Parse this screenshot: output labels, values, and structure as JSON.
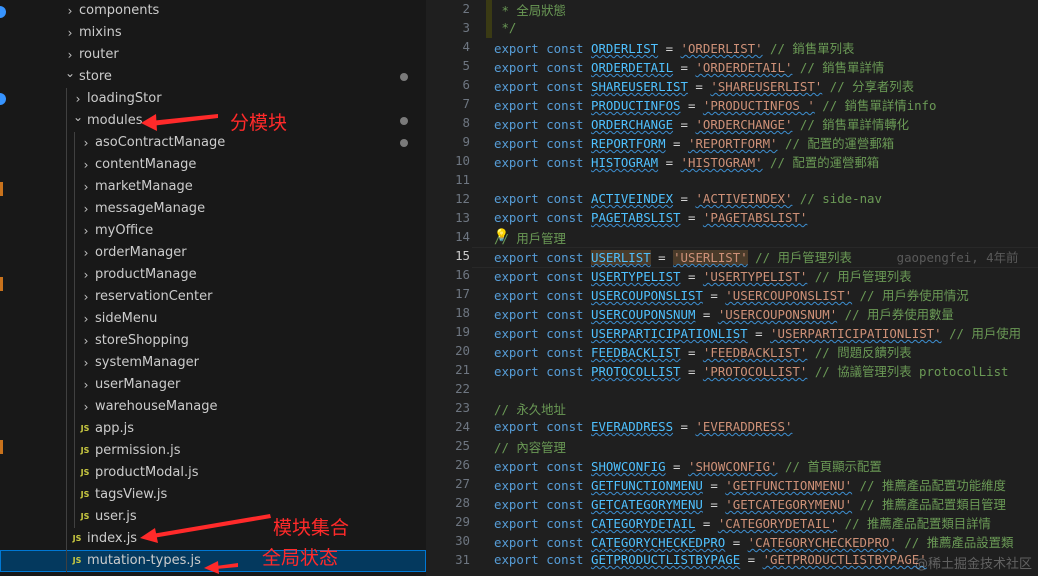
{
  "explorer": {
    "items": [
      {
        "label": "components",
        "type": "folder",
        "open": false,
        "depth": 1
      },
      {
        "label": "mixins",
        "type": "folder",
        "open": false,
        "depth": 1
      },
      {
        "label": "router",
        "type": "folder",
        "open": false,
        "depth": 1
      },
      {
        "label": "store",
        "type": "folder",
        "open": true,
        "depth": 1,
        "modified": true
      },
      {
        "label": "loadingStor",
        "type": "folder",
        "open": false,
        "depth": 2
      },
      {
        "label": "modules",
        "type": "folder",
        "open": true,
        "depth": 2,
        "modified": true
      },
      {
        "label": "asoContractManage",
        "type": "folder",
        "open": false,
        "depth": 3,
        "modified": true
      },
      {
        "label": "contentManage",
        "type": "folder",
        "open": false,
        "depth": 3
      },
      {
        "label": "marketManage",
        "type": "folder",
        "open": false,
        "depth": 3
      },
      {
        "label": "messageManage",
        "type": "folder",
        "open": false,
        "depth": 3
      },
      {
        "label": "myOffice",
        "type": "folder",
        "open": false,
        "depth": 3
      },
      {
        "label": "orderManager",
        "type": "folder",
        "open": false,
        "depth": 3
      },
      {
        "label": "productManage",
        "type": "folder",
        "open": false,
        "depth": 3
      },
      {
        "label": "reservationCenter",
        "type": "folder",
        "open": false,
        "depth": 3
      },
      {
        "label": "sideMenu",
        "type": "folder",
        "open": false,
        "depth": 3
      },
      {
        "label": "storeShopping",
        "type": "folder",
        "open": false,
        "depth": 3
      },
      {
        "label": "systemManager",
        "type": "folder",
        "open": false,
        "depth": 3
      },
      {
        "label": "userManager",
        "type": "folder",
        "open": false,
        "depth": 3
      },
      {
        "label": "warehouseManage",
        "type": "folder",
        "open": false,
        "depth": 3
      },
      {
        "label": "app.js",
        "type": "js",
        "depth": 3
      },
      {
        "label": "permission.js",
        "type": "js",
        "depth": 3
      },
      {
        "label": "productModal.js",
        "type": "js",
        "depth": 3
      },
      {
        "label": "tagsView.js",
        "type": "js",
        "depth": 3
      },
      {
        "label": "user.js",
        "type": "js",
        "depth": 3
      },
      {
        "label": "index.js",
        "type": "js",
        "depth": 2
      },
      {
        "label": "mutation-types.js",
        "type": "js",
        "depth": 2,
        "selected": true
      }
    ],
    "js_icon_text": "JS"
  },
  "annotations": {
    "modules_label": "分模块",
    "index_label": "模块集合",
    "mutation_label": "全局状态"
  },
  "editor": {
    "active_line": 15,
    "blame": "gaopengfei, 4年前",
    "lines": [
      {
        "n": 2,
        "t": "doc",
        "text": " * 全局狀態"
      },
      {
        "n": 3,
        "t": "doc",
        "text": " */"
      },
      {
        "n": 4,
        "t": "exp",
        "name": "ORDERLIST",
        "value": "'ORDERLIST'",
        "comment": "// 銷售單列表"
      },
      {
        "n": 5,
        "t": "exp",
        "name": "ORDERDETAIL",
        "value": "'ORDERDETAIL'",
        "comment": "// 銷售單詳情"
      },
      {
        "n": 6,
        "t": "exp",
        "name": "SHAREUSERLIST",
        "value": "'SHAREUSERLIST'",
        "comment": "// 分享者列表"
      },
      {
        "n": 7,
        "t": "exp",
        "name": "PRODUCTINFOS",
        "value": "'PRODUCTINFOS '",
        "comment": "// 銷售單詳情info"
      },
      {
        "n": 8,
        "t": "exp",
        "name": "ORDERCHANGE",
        "value": "'ORDERCHANGE'",
        "comment": "// 銷售單詳情轉化"
      },
      {
        "n": 9,
        "t": "exp",
        "name": "REPORTFORM",
        "value": "'REPORTFORM'",
        "comment": "// 配置的運營郵箱"
      },
      {
        "n": 10,
        "t": "exp",
        "name": "HISTOGRAM",
        "value": "'HISTOGRAM'",
        "comment": "// 配置的運營郵箱"
      },
      {
        "n": 11,
        "t": "blank"
      },
      {
        "n": 12,
        "t": "exp",
        "name": "ACTIVEINDEX",
        "value": "'ACTIVEINDEX'",
        "comment": "// side-nav"
      },
      {
        "n": 13,
        "t": "exp",
        "name": "PAGETABSLIST",
        "value": "'PAGETABSLIST'",
        "comment": ""
      },
      {
        "n": 14,
        "t": "cm",
        "text": "// 用戶管理"
      },
      {
        "n": 15,
        "t": "exp",
        "name": "USERLIST",
        "value": "'USERLIST'",
        "comment": "// 用戶管理列表"
      },
      {
        "n": 16,
        "t": "exp",
        "name": "USERTYPELIST",
        "value": "'USERTYPELIST'",
        "comment": "// 用戶管理列表"
      },
      {
        "n": 17,
        "t": "exp",
        "name": "USERCOUPONSLIST",
        "value": "'USERCOUPONSLIST'",
        "comment": "// 用戶券使用情況"
      },
      {
        "n": 18,
        "t": "exp",
        "name": "USERCOUPONSNUM",
        "value": "'USERCOUPONSNUM'",
        "comment": "// 用戶券使用數量"
      },
      {
        "n": 19,
        "t": "exp",
        "name": "USERPARTICIPATIONLIST",
        "value": "'USERPARTICIPATIONLIST'",
        "comment": "// 用戶使用"
      },
      {
        "n": 20,
        "t": "exp",
        "name": "FEEDBACKLIST",
        "value": "'FEEDBACKLIST'",
        "comment": "// 問題反饋列表"
      },
      {
        "n": 21,
        "t": "exp",
        "name": "PROTOCOLLIST",
        "value": "'PROTOCOLLIST'",
        "comment": "// 協議管理列表 protocolList"
      },
      {
        "n": 22,
        "t": "blank"
      },
      {
        "n": 23,
        "t": "cm",
        "text": "// 永久地址"
      },
      {
        "n": 24,
        "t": "exp",
        "name": "EVERADDRESS",
        "value": "'EVERADDRESS'",
        "comment": ""
      },
      {
        "n": 25,
        "t": "cm",
        "text": "// 內容管理"
      },
      {
        "n": 26,
        "t": "exp",
        "name": "SHOWCONFIG",
        "value": "'SHOWCONFIG'",
        "comment": "// 首頁顯示配置"
      },
      {
        "n": 27,
        "t": "exp",
        "name": "GETFUNCTIONMENU",
        "value": "'GETFUNCTIONMENU'",
        "comment": "// 推薦產品配置功能維度"
      },
      {
        "n": 28,
        "t": "exp",
        "name": "GETCATEGORYMENU",
        "value": "'GETCATEGORYMENU'",
        "comment": "// 推薦產品配置類目管理"
      },
      {
        "n": 29,
        "t": "exp",
        "name": "CATEGORYDETAIL",
        "value": "'CATEGORYDETAIL'",
        "comment": "// 推薦產品配置類目詳情"
      },
      {
        "n": 30,
        "t": "exp",
        "name": "CATEGORYCHECKEDPRO",
        "value": "'CATEGORYCHECKEDPRO'",
        "comment": "// 推薦產品設置類"
      },
      {
        "n": 31,
        "t": "exp",
        "name": "GETPRODUCTLISTBYPAGE",
        "value": "'GETPRODUCTLISTBYPAGE'",
        "comment": ""
      }
    ]
  },
  "watermark": "@稀土掘金技术社区",
  "colors": {
    "keyword": "#569cd6",
    "identifier": "#4fc1ff",
    "string": "#ce9178",
    "comment": "#6a9955",
    "annotation": "#ff2a2a",
    "selection": "#04395e"
  }
}
